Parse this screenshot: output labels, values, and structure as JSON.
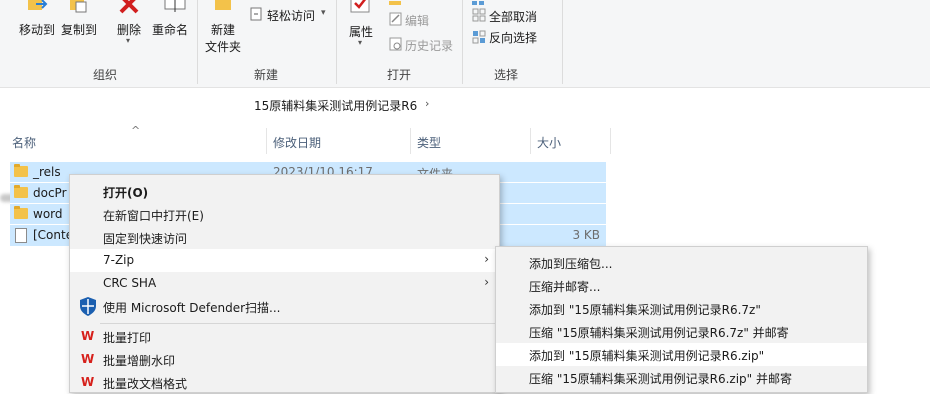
{
  "ribbon": {
    "organize": {
      "label": "组织",
      "move_to": "移动到",
      "copy_to": "复制到",
      "delete": "删除",
      "rename": "重命名"
    },
    "new_group": {
      "label": "新建",
      "new_folder_line1": "新建",
      "new_folder_line2": "文件夹",
      "easy_access": "轻松访问"
    },
    "open_group": {
      "label": "打开",
      "properties": "属性",
      "edit": "编辑",
      "history": "历史记录"
    },
    "select_group": {
      "label": "选择",
      "select_none": "全部取消",
      "invert": "反向选择"
    }
  },
  "address": {
    "current": "15原辅料集采测试用例记录R6"
  },
  "columns": {
    "name": "名称",
    "date": "修改日期",
    "type": "类型",
    "size": "大小"
  },
  "files": [
    {
      "name": "_rels",
      "date": "2023/1/10 16:17",
      "type": "文件夹",
      "size": "",
      "icon": "folder-icon"
    },
    {
      "name": "docPr",
      "date": "",
      "type": "",
      "size": "",
      "icon": "folder-icon"
    },
    {
      "name": "word",
      "date": "",
      "type": "",
      "size": "",
      "icon": "folder-icon"
    },
    {
      "name": "[Conte",
      "date": "",
      "type": "",
      "size": "3 KB",
      "icon": "file-icon"
    }
  ],
  "context_menu": {
    "items": [
      {
        "label": "打开(O)"
      },
      {
        "label": "在新窗口中打开(E)"
      },
      {
        "label": "固定到快速访问"
      },
      {
        "label": "7-Zip"
      },
      {
        "label": "CRC SHA"
      },
      {
        "label": "使用 Microsoft Defender扫描..."
      },
      {
        "label": "批量打印"
      },
      {
        "label": "批量增删水印"
      },
      {
        "label": "批量改文档格式"
      }
    ]
  },
  "submenu": {
    "items": [
      {
        "label": "添加到压缩包..."
      },
      {
        "label": "压缩并邮寄..."
      },
      {
        "label": "添加到 \"15原辅料集采测试用例记录R6.7z\""
      },
      {
        "label": "压缩 \"15原辅料集采测试用例记录R6.7z\" 并邮寄"
      },
      {
        "label": "添加到 \"15原辅料集采测试用例记录R6.zip\""
      },
      {
        "label": "压缩 \"15原辅料集采测试用例记录R6.zip\" 并邮寄"
      }
    ]
  },
  "colors": {
    "selection": "#cce8ff",
    "menu_bg": "#f2f2f2",
    "delete_red": "#d11f1f",
    "wps_red": "#d6201b"
  }
}
